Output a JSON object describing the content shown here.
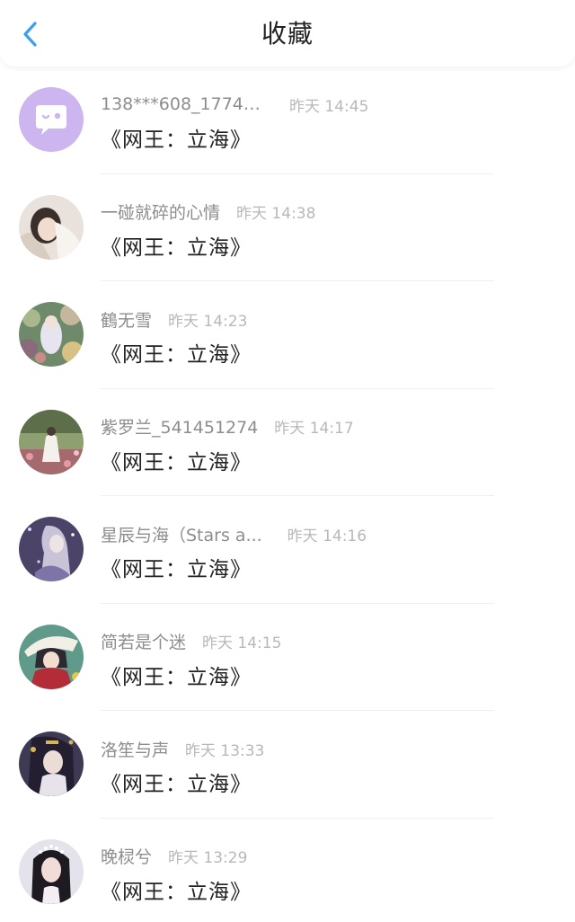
{
  "header": {
    "title": "收藏",
    "accent_color": "#3b9ef0",
    "back_icon": "chevron-left-icon"
  },
  "items": [
    {
      "name": "138***608_17744...",
      "time": "昨天 14:45",
      "content": "《网王：立海》",
      "avatar": "default-chat-avatar"
    },
    {
      "name": "一碰就碎的心情",
      "time": "昨天 14:38",
      "content": "《网王：立海》",
      "avatar": "user-photo-avatar"
    },
    {
      "name": "鶴无雪",
      "time": "昨天 14:23",
      "content": "《网王：立海》",
      "avatar": "user-photo-avatar"
    },
    {
      "name": "紫罗兰_541451274",
      "time": "昨天 14:17",
      "content": "《网王：立海》",
      "avatar": "user-photo-avatar"
    },
    {
      "name": "星辰与海（Stars a...",
      "time": "昨天 14:16",
      "content": "《网王：立海》",
      "avatar": "user-photo-avatar"
    },
    {
      "name": "简若是个迷",
      "time": "昨天 14:15",
      "content": "《网王：立海》",
      "avatar": "user-photo-avatar"
    },
    {
      "name": "洛笙与声",
      "time": "昨天 13:33",
      "content": "《网王：立海》",
      "avatar": "user-photo-avatar"
    },
    {
      "name": "晚棂兮",
      "time": "昨天 13:29",
      "content": "《网王：立海》",
      "avatar": "user-photo-avatar"
    }
  ]
}
